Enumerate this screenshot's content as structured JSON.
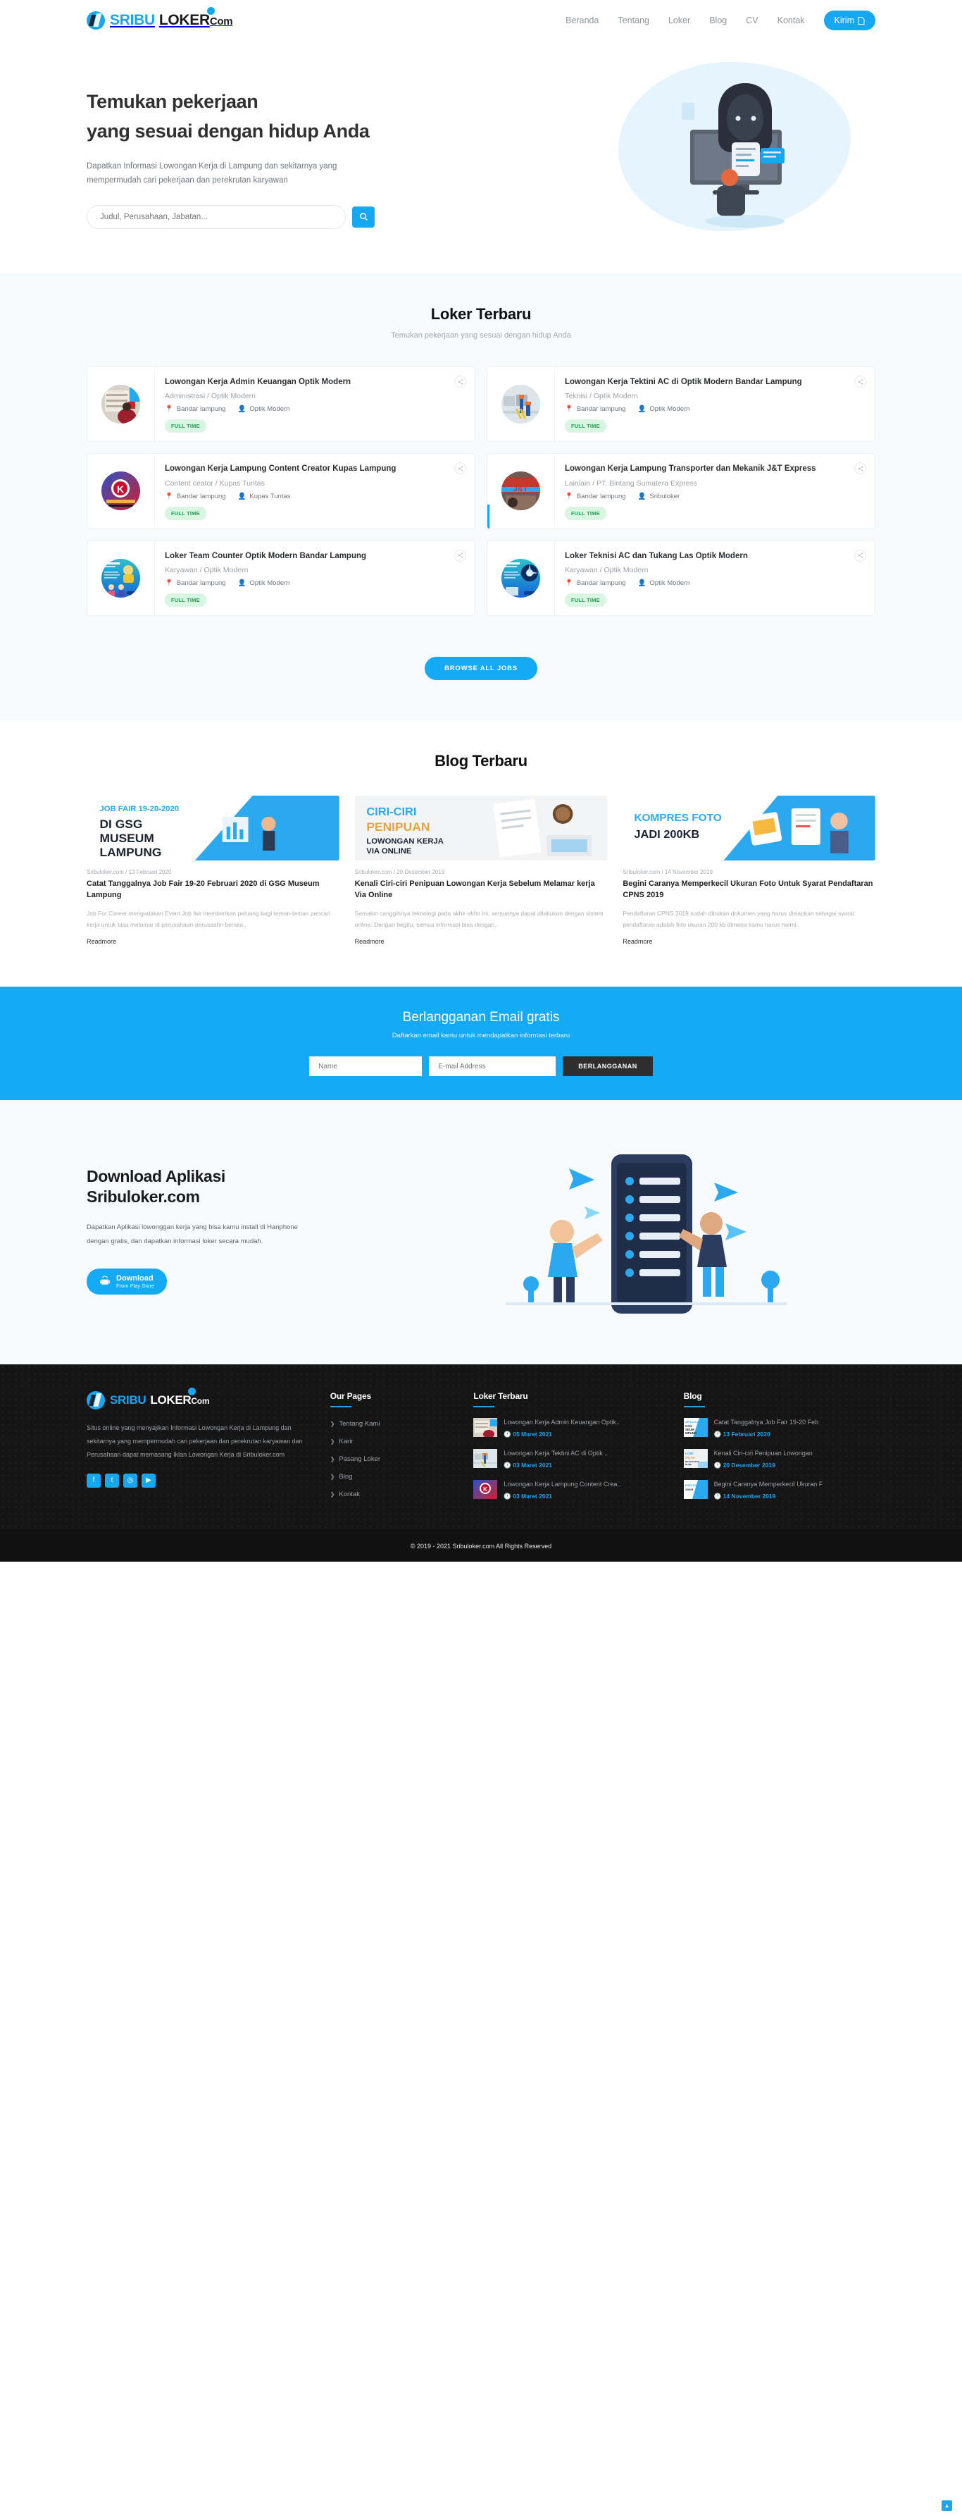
{
  "header": {
    "brand": {
      "sribu": "SRIBU",
      "loker": "LOKER",
      "com": "Com"
    },
    "nav": [
      {
        "label": "Beranda"
      },
      {
        "label": "Tentang"
      },
      {
        "label": "Loker"
      },
      {
        "label": "Blog"
      },
      {
        "label": "CV"
      },
      {
        "label": "Kontak"
      }
    ],
    "cta": "Kirim"
  },
  "hero": {
    "title_line1": "Temukan pekerjaan",
    "title_line2": "yang sesuai dengan hidup Anda",
    "paragraph": "Dapatkan Informasi Lowongan Kerja di Lampung dan sekitarnya yang mempermudah cari pekerjaan dan perekrutan karyawan",
    "search_placeholder": "Judul, Perusahaan, Jabatan...",
    "search_value": ""
  },
  "loker": {
    "title": "Loker Terbaru",
    "subtitle": "Temukan pekerjaan yang sesuai dengan hidup Anda",
    "browse_label": "BROWSE ALL JOBS",
    "jobs": [
      {
        "title": "Lowongan Kerja Admin Keuangan Optik Modern",
        "meta": "Administrasi / Optik Modern",
        "location": "Bandar lampung",
        "company": "Optik Modern",
        "badge": "FULL TIME",
        "thumb": "optik-store"
      },
      {
        "title": "Lowongan Kerja Tektini AC di Optik Modern Bandar Lampung",
        "meta": "Teknisi / Optik Modern",
        "location": "Bandar lampung",
        "company": "Optik Modern",
        "badge": "FULL TIME",
        "thumb": "ac-technician"
      },
      {
        "title": "Lowongan Kerja Lampung Content Creator Kupas Lampung",
        "meta": "Content ceator / Kupas Tuntas",
        "location": "Bandar lampung",
        "company": "Kupas Tuntas",
        "badge": "FULL TIME",
        "thumb": "kupastuntas-logo"
      },
      {
        "title": "Lowongan Kerja Lampung Transporter dan Mekanik J&T Express",
        "meta": "Lainlain / PT. Bintang Sumatera Express",
        "location": "Bandar lampung",
        "company": "Sribuloker",
        "badge": "FULL TIME",
        "thumb": "jnt-express"
      },
      {
        "title": "Loker Team Counter Optik Modern Bandar Lampung",
        "meta": "Karyawan / Optik Modern",
        "location": "Bandar lampung",
        "company": "Optik Modern",
        "badge": "FULL TIME",
        "thumb": "hiring-poster-counter"
      },
      {
        "title": "Loker Teknisi AC dan Tukang Las Optik Modern",
        "meta": "Karyawan / Optik Modern",
        "location": "Bandar lampung",
        "company": "Optik Modern",
        "badge": "FULL TIME",
        "thumb": "hiring-poster-welding"
      }
    ]
  },
  "blog": {
    "title": "Blog Terbaru",
    "posts": [
      {
        "source": "Sribuloker.com / 13 Februari 2020",
        "title": "Catat Tanggalnya Job Fair 19-20 Februari 2020 di GSG Museum Lampung",
        "excerpt": "Job For Career mengadakan Event Job fair memberikan peluang bagi teman-teman pencari kerja untuk bisa melamar di perusahaan-perusaahn berska..",
        "more": "Readmore",
        "img_text": "JOB FAIR 19-20-2020 DI GSG MUSEUM LAMPUNG"
      },
      {
        "source": "Sribuloker.com / 20 Desember 2019",
        "title": "Kenali Ciri-ciri Penipuan Lowongan Kerja Sebelum Melamar kerja Via Online",
        "excerpt": "Semakin canggihnya teknologi pada akhir-akhir ini, semuanya dapat dilakukan dengan sistem online. Dengan begitu, semua informasi bisa dengan..",
        "more": "Readmore",
        "img_text": "CIRI-CIRI PENIPUAN LOWONGAN KERJA VIA ONLINE"
      },
      {
        "source": "Sribuloker.com / 14 November 2019",
        "title": "Begini Caranya Memperkecil Ukuran Foto Untuk Syarat Pendaftaran CPNS 2019",
        "excerpt": "Pendaftaran CPNS 2019 sudah dibukan dokumen yang harus disiapkan sebagai syarat pendaftaran adalah foto ukuran 200 kb dimana kamu harus memi..",
        "more": "Readmore",
        "img_text": "KOMPRES FOTO JADI 200KB"
      }
    ]
  },
  "newsletter": {
    "title": "Berlangganan Email gratis",
    "subtitle": "Daftarkan email kamu untuk mendapatkan informasi terbaru",
    "name_placeholder": "Name",
    "email_placeholder": "E-mail Address",
    "button": "BERLANGGANAN"
  },
  "app": {
    "title_line1": "Download Aplikasi",
    "title_line2": "Sribuloker.com",
    "paragraph": "Dapatkan Aplikasi lowonggan kerja yang bisa kamu install di Hanphone dengan gratis, dan dapatkan informasi loker secara mudah.",
    "btn_main": "Download",
    "btn_sub": "From Play Store"
  },
  "footer": {
    "brand": {
      "sribu": "SRIBU",
      "loker": "LOKER",
      "com": "Com"
    },
    "about": "Situs online yang menyajikan Informasi Lowongan Kerja di Lampung dan sekitarnya yang mempermudah cari pekerjaan dan perekrutan karyawan dan Perusahaan dapat memasang Iklan Lowongan Kerja di Sribuloker.com",
    "socials": [
      {
        "name": "facebook-icon",
        "glyph": "f"
      },
      {
        "name": "twitter-icon",
        "glyph": "t"
      },
      {
        "name": "instagram-icon",
        "glyph": "◎"
      },
      {
        "name": "youtube-icon",
        "glyph": "▶"
      }
    ],
    "pages_head": "Our Pages",
    "pages": [
      {
        "label": "Tentang Kami"
      },
      {
        "label": "Karir"
      },
      {
        "label": "Pasang Loker"
      },
      {
        "label": "Blog"
      },
      {
        "label": "Kontak"
      }
    ],
    "loker_head": "Loker Terbaru",
    "loker_items": [
      {
        "title": "Lowongan Kerja Admin Keuangan Optik..",
        "date": "05 Maret 2021",
        "thumb": "optik-store"
      },
      {
        "title": "Lowongan Kerja Tektini AC di Optik ..",
        "date": "03 Maret 2021",
        "thumb": "ac-technician"
      },
      {
        "title": "Lowongan Kerja Lampung Content Crea..",
        "date": "03 Maret 2021",
        "thumb": "kupastuntas-logo"
      }
    ],
    "blog_head": "Blog",
    "blog_items": [
      {
        "title": "Catat Tanggalnya Job Fair 19-20 Feb",
        "date": "13 Februari 2020",
        "thumb": "jobfair-poster"
      },
      {
        "title": "Kenali Ciri-ciri Penipuan Lowongan",
        "date": "20 Desember 2019",
        "thumb": "penipuan-poster"
      },
      {
        "title": "Begini Caranya Memperkecil Ukuran F",
        "date": "14 November 2019",
        "thumb": "kompres-poster"
      }
    ],
    "copyright": "© 2019 - 2021 Sribuloker.com All Rights Reserved"
  },
  "colors": {
    "accent": "#16a7f0",
    "dark": "#151515",
    "badge_bg": "#d8f6e2",
    "badge_fg": "#20a353"
  }
}
